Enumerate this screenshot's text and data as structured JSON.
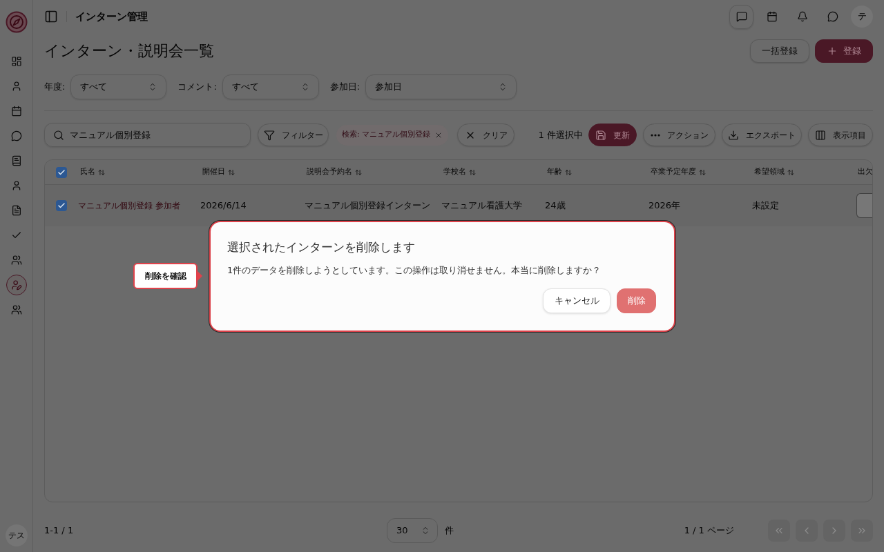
{
  "sidebar": {
    "items": [
      {
        "selected": false
      },
      {
        "selected": false
      },
      {
        "selected": false
      },
      {
        "selected": false
      },
      {
        "selected": false
      },
      {
        "selected": false
      },
      {
        "selected": false
      },
      {
        "selected": false
      },
      {
        "selected": false
      },
      {
        "selected": true
      },
      {
        "selected": false
      }
    ],
    "user_avatar": "テス"
  },
  "header": {
    "title": "インターン管理",
    "avatar": "テ"
  },
  "page": {
    "title": "インターン・説明会一覧",
    "buttons": [
      {
        "label": "一括登録",
        "kind": "secondary"
      },
      {
        "label": "登録",
        "kind": "primary"
      }
    ]
  },
  "filters": [
    {
      "label": "年度:",
      "value": "すべて"
    },
    {
      "label": "コメント:",
      "value": "すべて"
    },
    {
      "label": "参加日:",
      "value": "参加日"
    }
  ],
  "toolbar": {
    "search": {
      "value": "マニュアル個別登録"
    },
    "filter_button": "フィルター",
    "chips": [
      {
        "label": "検索: マニュアル個別登録"
      }
    ],
    "clear_button": "クリア",
    "selection_count": "1 件選択中",
    "actions": [
      {
        "label": "更新",
        "kind": "primary"
      },
      {
        "label": "アクション",
        "kind": "secondary"
      },
      {
        "label": "エクスポート",
        "kind": "secondary"
      },
      {
        "label": "表示項目",
        "kind": "secondary"
      }
    ]
  },
  "table": {
    "all_selected": true,
    "columns": [
      "氏名",
      "開催日",
      "説明会予約名",
      "学校名",
      "年齢",
      "卒業予定年度",
      "希望領域",
      "出欠"
    ],
    "rows": [
      {
        "selected": true,
        "cells": [
          "マニュアル個別登録 参加者",
          "2026/6/14",
          "マニュアル個別登録インターン",
          "マニュアル看護大学",
          "24歳",
          "2026年",
          "未設定"
        ]
      }
    ]
  },
  "pagination": {
    "range": "1-1 / 1",
    "page_size": "30",
    "unit": "件",
    "page_info": "1 / 1 ページ",
    "nav": [
      {
        "disabled": true
      },
      {
        "disabled": true
      },
      {
        "disabled": true
      },
      {
        "disabled": true
      }
    ]
  },
  "dialog": {
    "title": "選択されたインターンを削除します",
    "message": "1件のデータを削除しようとしています。この操作は取り消せません。本当に削除しますか？",
    "buttons": [
      {
        "label": "キャンセル",
        "kind": "cancel"
      },
      {
        "label": "削除",
        "kind": "destructive"
      }
    ]
  },
  "annotation": {
    "label": "削除を確認"
  }
}
